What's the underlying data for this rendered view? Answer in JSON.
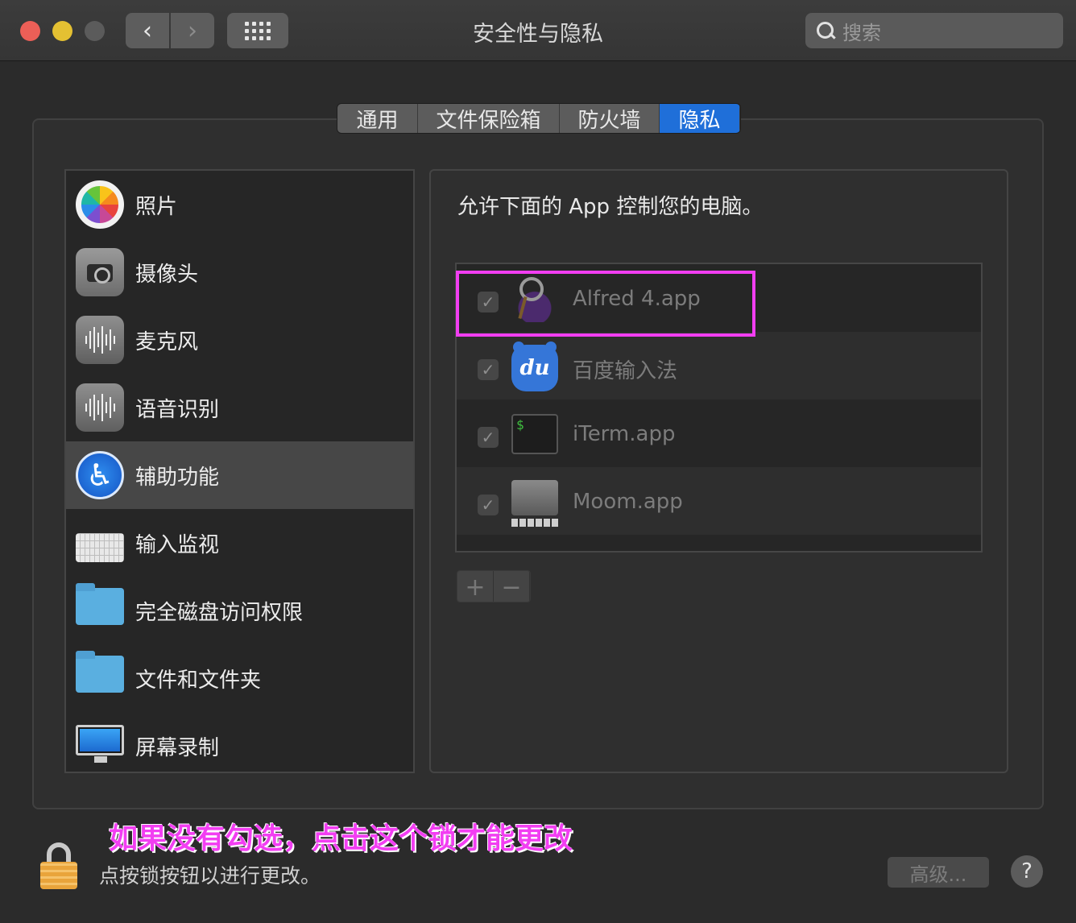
{
  "window": {
    "title": "安全性与隐私"
  },
  "toolbar": {
    "back_icon": "‹",
    "forward_icon": "›",
    "search_placeholder": "搜索"
  },
  "tabs": [
    {
      "label": "通用"
    },
    {
      "label": "文件保险箱"
    },
    {
      "label": "防火墙"
    },
    {
      "label": "隐私",
      "active": true
    }
  ],
  "sidebar": {
    "items": [
      {
        "label": "照片",
        "icon": "photos-icon"
      },
      {
        "label": "摄像头",
        "icon": "camera-icon"
      },
      {
        "label": "麦克风",
        "icon": "microphone-icon"
      },
      {
        "label": "语音识别",
        "icon": "speech-recognition-icon"
      },
      {
        "label": "辅助功能",
        "icon": "accessibility-icon",
        "selected": true
      },
      {
        "label": "输入监视",
        "icon": "keyboard-icon"
      },
      {
        "label": "完全磁盘访问权限",
        "icon": "folder-icon"
      },
      {
        "label": "文件和文件夹",
        "icon": "folder-icon"
      },
      {
        "label": "屏幕录制",
        "icon": "display-icon"
      }
    ]
  },
  "main": {
    "heading": "允许下面的 App 控制您的电脑。",
    "apps": [
      {
        "name": "Alfred 4.app",
        "checked": true,
        "icon": "alfred-icon"
      },
      {
        "name": "百度输入法",
        "checked": true,
        "icon": "baidu-ime-icon",
        "icon_text": "du"
      },
      {
        "name": "iTerm.app",
        "checked": true,
        "icon": "iterm-icon",
        "icon_text": "$"
      },
      {
        "name": "Moom.app",
        "checked": true,
        "icon": "moom-icon"
      }
    ],
    "add_label": "+",
    "remove_label": "−",
    "checkmark": "✓"
  },
  "annotation": {
    "text": "如果没有勾选，点击这个锁才能更改",
    "color": "#f23ef2"
  },
  "footer": {
    "lock_text": "点按锁按钮以进行更改。",
    "advanced_label": "高级...",
    "help_label": "?"
  },
  "colors": {
    "accent": "#1f6fd9",
    "highlight": "#f23ef2"
  }
}
